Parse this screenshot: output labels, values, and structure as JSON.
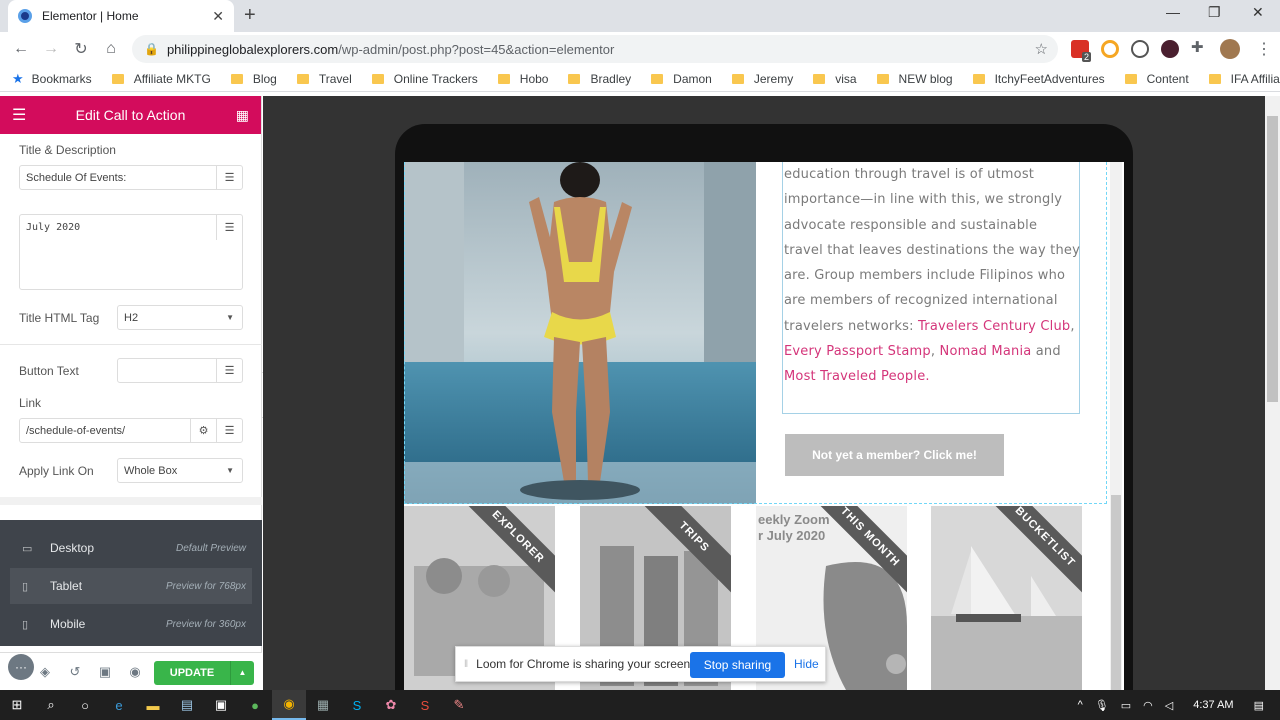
{
  "browser": {
    "tab_title": "Elementor | Home",
    "url_domain": "philippineglobalexplorers.com",
    "url_path": "/wp-admin/post.php?post=45&action=elementor",
    "extension_badge": "2",
    "bookmarks": [
      "Bookmarks",
      "Affiliate MKTG",
      "Blog",
      "Travel",
      "Online Trackers",
      "Hobo",
      "Bradley",
      "Damon",
      "Jeremy",
      "visa",
      "NEW blog",
      "ItchyFeetAdventures",
      "Content",
      "IFA Affiliates"
    ]
  },
  "panel": {
    "title": "Edit Call to Action",
    "accent": "#d30c5c",
    "section_label": "Title & Description",
    "title_value": "Schedule Of Events:",
    "description_value": "July 2020",
    "html_tag_label": "Title HTML Tag",
    "html_tag_value": "H2",
    "button_text_label": "Button Text",
    "button_text_value": "",
    "link_label": "Link",
    "link_value": "/schedule-of-events/",
    "apply_link_label": "Apply Link On",
    "apply_link_value": "Whole Box",
    "responsive": [
      {
        "label": "Desktop",
        "note": "Default Preview"
      },
      {
        "label": "Tablet",
        "note": "Preview for 768px"
      },
      {
        "label": "Mobile",
        "note": "Preview for 360px"
      }
    ],
    "update_label": "UPDATE",
    "update_color": "#39b54a"
  },
  "preview": {
    "text_plain_1": "education through travel is of utmost importance—in line with this, we strongly advocate responsible and sustainable travel that leaves destinations the way they are. Group members include Filipinos who are members of recognized international travelers networks: ",
    "link_1": "Travelers Century Club",
    "sep_1": ", ",
    "link_2": "Every Passport Stamp",
    "sep_2": ", ",
    "link_3": "Nomad Mania",
    "sep_3": " and ",
    "link_4": "Most Traveled People",
    "end": ".",
    "cta_button": "Not yet a member? Click me!",
    "cards": [
      {
        "ribbon": "EXPLORER"
      },
      {
        "ribbon": "TRIPS"
      },
      {
        "ribbon": "THIS MONTH",
        "text_1": "eekly Zoom",
        "text_2": "r July 2020"
      },
      {
        "ribbon": "BUCKETLIST"
      }
    ]
  },
  "loom": {
    "message": "Loom for Chrome is sharing your screen.",
    "stop_label": "Stop sharing",
    "hide_label": "Hide"
  },
  "taskbar": {
    "time": "4:37 AM"
  }
}
